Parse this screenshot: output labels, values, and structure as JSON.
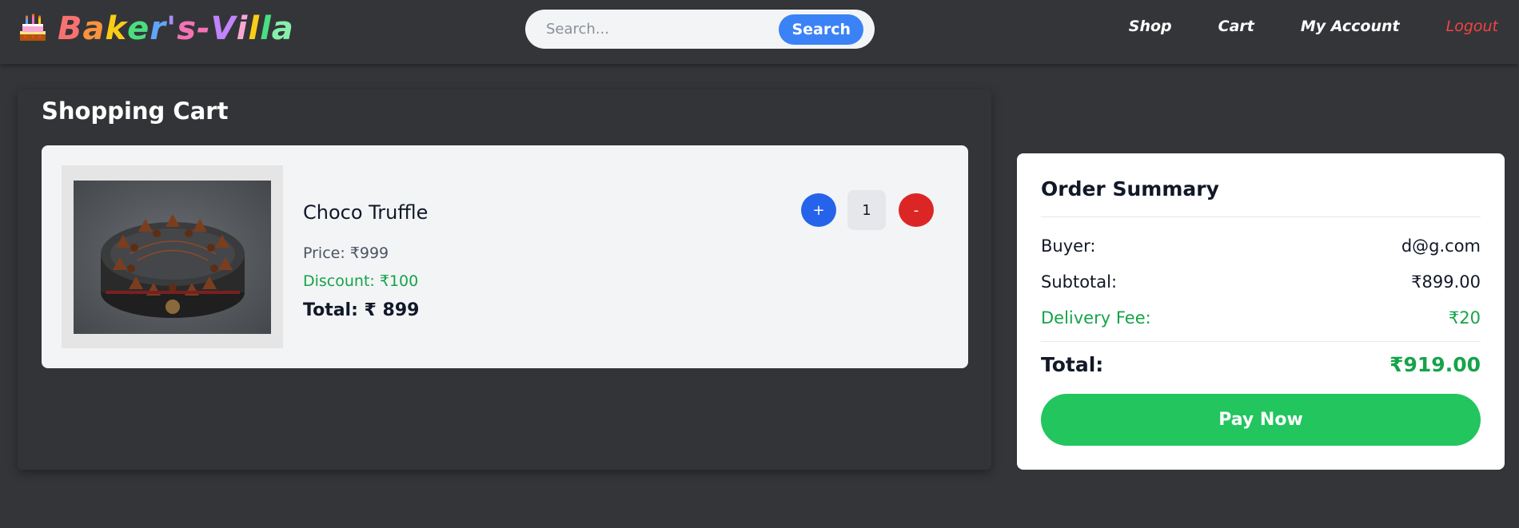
{
  "brand": {
    "name_letters": [
      "B",
      "a",
      "k",
      "e",
      "r",
      "'",
      "s",
      "-",
      "V",
      "i",
      "l",
      "l",
      "a"
    ],
    "letter_colors": [
      "#f87171",
      "#fb923c",
      "#facc15",
      "#4ade80",
      "#60a5fa",
      "#a78bfa",
      "#f472b6",
      "#f472b6",
      "#c084fc",
      "#f9a8d4",
      "#facc15",
      "#4ade80",
      "#86efac"
    ],
    "icon": "cake-icon"
  },
  "search": {
    "placeholder": "Search...",
    "button_label": "Search"
  },
  "nav": {
    "shop": "Shop",
    "cart": "Cart",
    "account": "My Account",
    "logout": "Logout"
  },
  "cart": {
    "title": "Shopping Cart",
    "item": {
      "name": "Choco Truffle",
      "price": "Price: ₹999",
      "discount": "Discount: ₹100",
      "total": "Total: ₹ 899",
      "quantity": "1",
      "plus_label": "+",
      "minus_label": "-"
    }
  },
  "summary": {
    "title": "Order Summary",
    "buyer_label": "Buyer:",
    "buyer_value": "d@g.com",
    "subtotal_label": "Subtotal:",
    "subtotal_value": "₹899.00",
    "delivery_label": "Delivery Fee:",
    "delivery_value": "₹20",
    "total_label": "Total:",
    "total_value": "₹919.00",
    "pay_label": "Pay Now"
  },
  "colors": {
    "background": "#343538",
    "accent_blue": "#3b82f6",
    "accent_green": "#22c55e",
    "danger": "#ef4444"
  }
}
